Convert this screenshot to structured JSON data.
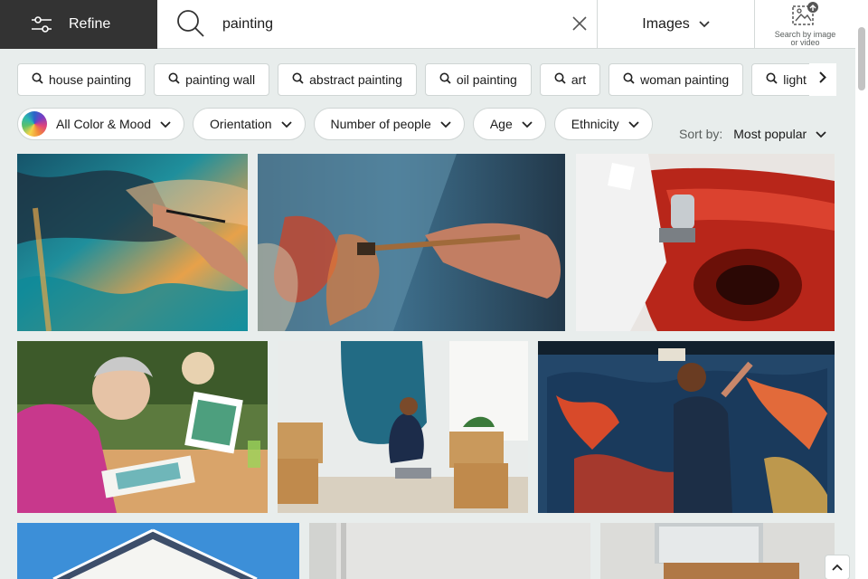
{
  "refine": {
    "label": "Refine"
  },
  "search": {
    "query": "painting"
  },
  "media": {
    "label": "Images"
  },
  "search_by_image": {
    "line1": "Search by image",
    "line2": "or video"
  },
  "related": [
    {
      "label": "house painting"
    },
    {
      "label": "painting wall"
    },
    {
      "label": "abstract painting"
    },
    {
      "label": "oil painting"
    },
    {
      "label": "art"
    },
    {
      "label": "woman painting"
    },
    {
      "label": "light p"
    }
  ],
  "filters": {
    "color": "All Color & Mood",
    "orientation": "Orientation",
    "people": "Number of people",
    "age": "Age",
    "ethnicity": "Ethnicity"
  },
  "sort": {
    "label": "Sort by:",
    "value": "Most popular"
  },
  "images": [
    {
      "subject": "hand painting colorful abstract canvas"
    },
    {
      "subject": "brush applying red and blue paint"
    },
    {
      "subject": "spray painting red car"
    },
    {
      "subject": "senior woman painting watercolor"
    },
    {
      "subject": "woman painting wall teal"
    },
    {
      "subject": "man painting large abstract mural"
    },
    {
      "subject": "house roof against blue sky"
    },
    {
      "subject": "white interior room"
    },
    {
      "subject": "window with wooden sill"
    }
  ],
  "colors": {
    "dark": "#333333",
    "background": "#e8edec",
    "chip_border": "#cfd5d4"
  }
}
